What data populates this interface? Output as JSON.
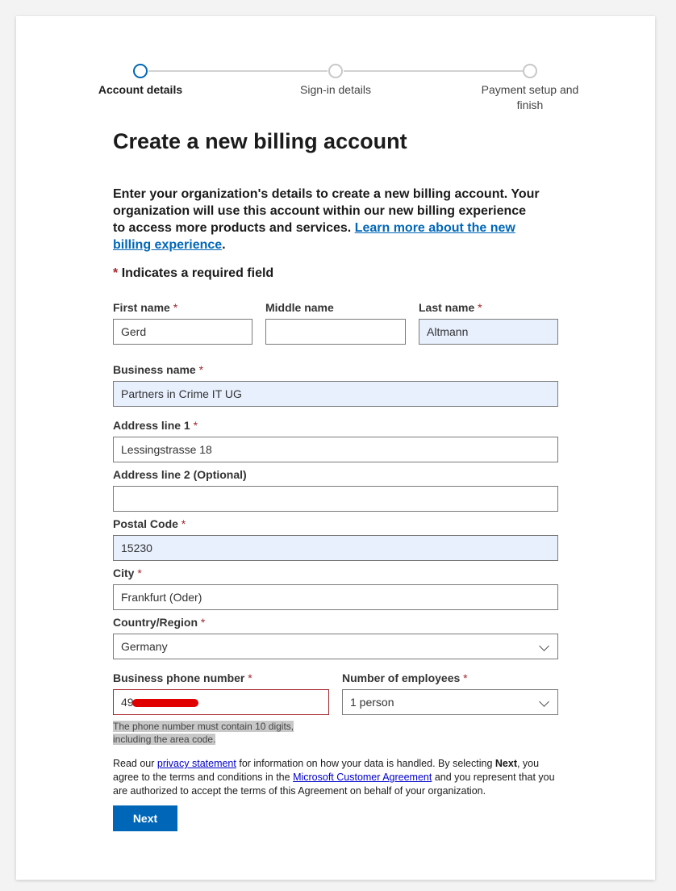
{
  "stepper": {
    "steps": [
      {
        "label": "Account details"
      },
      {
        "label": "Sign-in details"
      },
      {
        "label": "Payment setup and finish"
      }
    ]
  },
  "page": {
    "title": "Create a new billing account",
    "intro_text": "Enter your organization's details to create a new billing account. Your organization will use this account within our new billing experience to access more products and services. ",
    "intro_link": "Learn more about the new billing experience",
    "intro_end": ".",
    "required_note": "Indicates a required field",
    "required_star": "*"
  },
  "form": {
    "first_name": {
      "label": "First name",
      "value": "Gerd"
    },
    "middle_name": {
      "label": "Middle name",
      "value": ""
    },
    "last_name": {
      "label": "Last name",
      "value": "Altmann"
    },
    "business_name": {
      "label": "Business name",
      "value": "Partners in Crime IT UG"
    },
    "address1": {
      "label": "Address line 1",
      "value": "Lessingstrasse 18"
    },
    "address2": {
      "label": "Address line 2 (Optional)",
      "value": ""
    },
    "postal_code": {
      "label": "Postal Code",
      "value": "15230"
    },
    "city": {
      "label": "City",
      "value": "Frankfurt (Oder)"
    },
    "country": {
      "label": "Country/Region",
      "value": "Germany"
    },
    "phone": {
      "label": "Business phone number",
      "value": "49",
      "error": "The phone number must contain 10 digits, including the area code."
    },
    "employees": {
      "label": "Number of employees",
      "value": "1 person"
    }
  },
  "legal": {
    "t1": "Read our ",
    "privacy_link": "privacy statement",
    "t2": " for information on how your data is handled. By selecting ",
    "next_bold": "Next",
    "t3": ", you agree to the terms and conditions in the ",
    "agreement_link": "Microsoft Customer Agreement",
    "t4": " and you represent that you are authorized to accept the terms of this Agreement on behalf of your organization."
  },
  "actions": {
    "next_label": "Next"
  },
  "colors": {
    "accent": "#0067b8",
    "error": "#a4262c",
    "autofill": "#e8f0fe"
  }
}
